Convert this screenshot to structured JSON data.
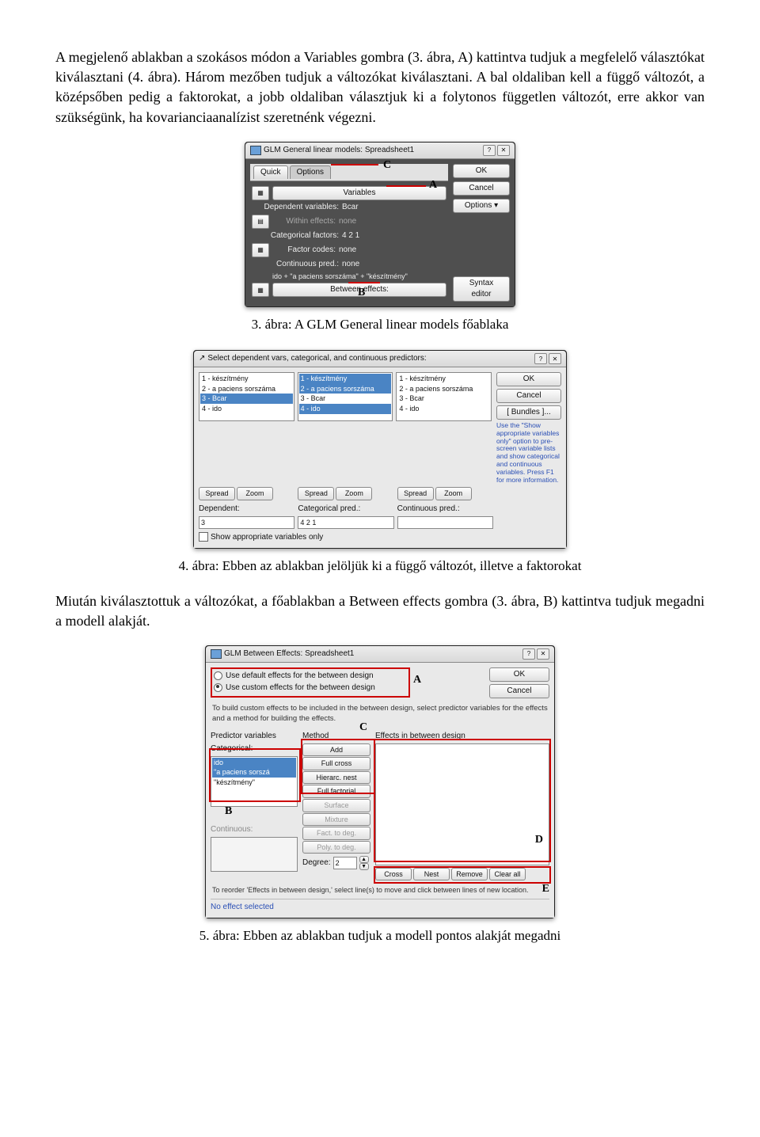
{
  "para1": "A megjelenő ablakban a szokásos módon a Variables gombra (3. ábra, A) kattintva tudjuk a megfelelő választókat kiválasztani (4. ábra). Három mezőben tudjuk a változókat kiválasztani. A bal oldaliban kell a függő változót, a középsőben pedig a faktorokat, a jobb oldaliban választjuk ki a folytonos független változót, erre akkor van szükségünk, ha kovarianciaanalízist szeretnénk végezni.",
  "cap3": "3. ábra: A GLM General linear models főablaka",
  "cap4": "4. ábra: Ebben az ablakban jelöljük ki a függő változót, illetve a faktorokat",
  "para2": "Miután kiválasztottuk a változókat, a főablakban a Between effects gombra (3. ábra, B) kattintva tudjuk megadni a modell alakját.",
  "cap5": "5. ábra: Ebben az ablakban tudjuk a modell pontos alakját megadni",
  "dlg3": {
    "title": "GLM General linear models: Spreadsheet1",
    "quick": "Quick",
    "options": "Options",
    "variables": "Variables",
    "dep_lbl": "Dependent variables:",
    "dep_val": "Bcar",
    "within_lbl": "Within effects:",
    "within_val": "none",
    "cat_lbl": "Categorical factors:",
    "cat_val": "4 2 1",
    "code_lbl": "Factor codes:",
    "code_val": "none",
    "cont_lbl": "Continuous pred.:",
    "cont_val": "none",
    "ido_line": "ido + \"a paciens sorszáma\" + \"készítmény\"",
    "between": "Between effects:",
    "ok": "OK",
    "cancel": "Cancel",
    "opt_btn": "Options",
    "syntax": "Syntax editor",
    "markA": "A",
    "markB": "B",
    "markC": "C"
  },
  "dlg4": {
    "title": "Select dependent vars, categorical, and continuous predictors:",
    "items": [
      "1 - készítmény",
      "2 - a paciens sorszáma",
      "3 - Bcar",
      "4 - ido"
    ],
    "spread": "Spread",
    "zoom": "Zoom",
    "dep_lbl": "Dependent:",
    "dep_val": "3",
    "catp_lbl": "Categorical pred.:",
    "catp_val": "4 2 1",
    "contp_lbl": "Continuous pred.:",
    "contp_val": "",
    "chk_lbl": "Show appropriate variables only",
    "ok": "OK",
    "cancel": "Cancel",
    "bundles": "[ Bundles ]...",
    "hint": "Use the \"Show appropriate variables only\" option to pre-screen variable lists and show categorical and continuous variables. Press F1 for more information."
  },
  "dlg5": {
    "title": "GLM Between Effects: Spreadsheet1",
    "r1": "Use default effects for the between design",
    "r2": "Use custom effects for the between design",
    "desc": "To build custom effects to be included in the between design, select predictor variables for the effects and a method for building the effects.",
    "pred_lbl": "Predictor variables",
    "cat_lbl": "Categorical:",
    "cont_lbl": "Continuous:",
    "list": [
      "ido",
      "\"a paciens sorszá",
      "\"készítmény\""
    ],
    "method_lbl": "Method",
    "eff_lbl": "Effects in between design",
    "btns": [
      "Add",
      "Full cross",
      "Hierarc. nest",
      "Full factorial",
      "Surface",
      "Mixture",
      "Fact. to deg.",
      "Poly. to deg."
    ],
    "degree_lbl": "Degree:",
    "degree_val": "2",
    "bottom_btns": [
      "Cross",
      "Nest",
      "Remove",
      "Clear all"
    ],
    "reorder": "To reorder 'Effects in between design,' select line(s) to move and click between lines of new location.",
    "noeff": "No effect selected",
    "ok": "OK",
    "cancel": "Cancel",
    "markA": "A",
    "markB": "B",
    "markC": "C",
    "markD": "D",
    "markE": "E"
  }
}
